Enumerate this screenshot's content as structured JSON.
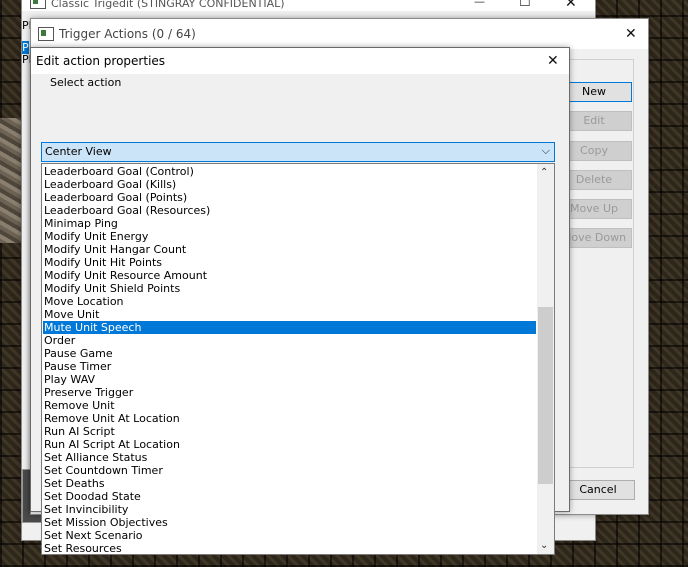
{
  "bg_window": {
    "title": "Classic Trigedit (STINGRAY CONFIDENTIAL)",
    "min_symbol": "—",
    "max_symbol": "☐",
    "close_symbol": "✕",
    "left_labels": [
      "Pl",
      "P",
      "Pl"
    ]
  },
  "trigger_window": {
    "title": "Trigger Actions (0 / 64)",
    "close_symbol": "✕",
    "buttons": {
      "new": "New",
      "edit": "Edit",
      "copy": "Copy",
      "delete": "Delete",
      "move_up": "Move Up",
      "move_down": "Move Down",
      "cancel": "Cancel"
    }
  },
  "edit_dialog": {
    "title": "Edit action properties",
    "close_symbol": "✕",
    "select_label": "Select action",
    "selected_value": "Center View",
    "dropdown_arrow": "⌵",
    "items": [
      "Leaderboard Goal (Control)",
      "Leaderboard Goal (Kills)",
      "Leaderboard Goal (Points)",
      "Leaderboard Goal (Resources)",
      "Minimap Ping",
      "Modify Unit Energy",
      "Modify Unit Hangar Count",
      "Modify Unit Hit Points",
      "Modify Unit Resource Amount",
      "Modify Unit Shield Points",
      "Move Location",
      "Move Unit",
      "Mute Unit Speech",
      "Order",
      "Pause Game",
      "Pause Timer",
      "Play WAV",
      "Preserve Trigger",
      "Remove Unit",
      "Remove Unit At Location",
      "Run AI Script",
      "Run AI Script At Location",
      "Set Alliance Status",
      "Set Countdown Timer",
      "Set Deaths",
      "Set Doodad State",
      "Set Invincibility",
      "Set Mission Objectives",
      "Set Next Scenario",
      "Set Resources"
    ],
    "highlighted_item": "Mute Unit Speech",
    "scroll_up_symbol": "⌃",
    "scroll_down_symbol": "⌄"
  }
}
